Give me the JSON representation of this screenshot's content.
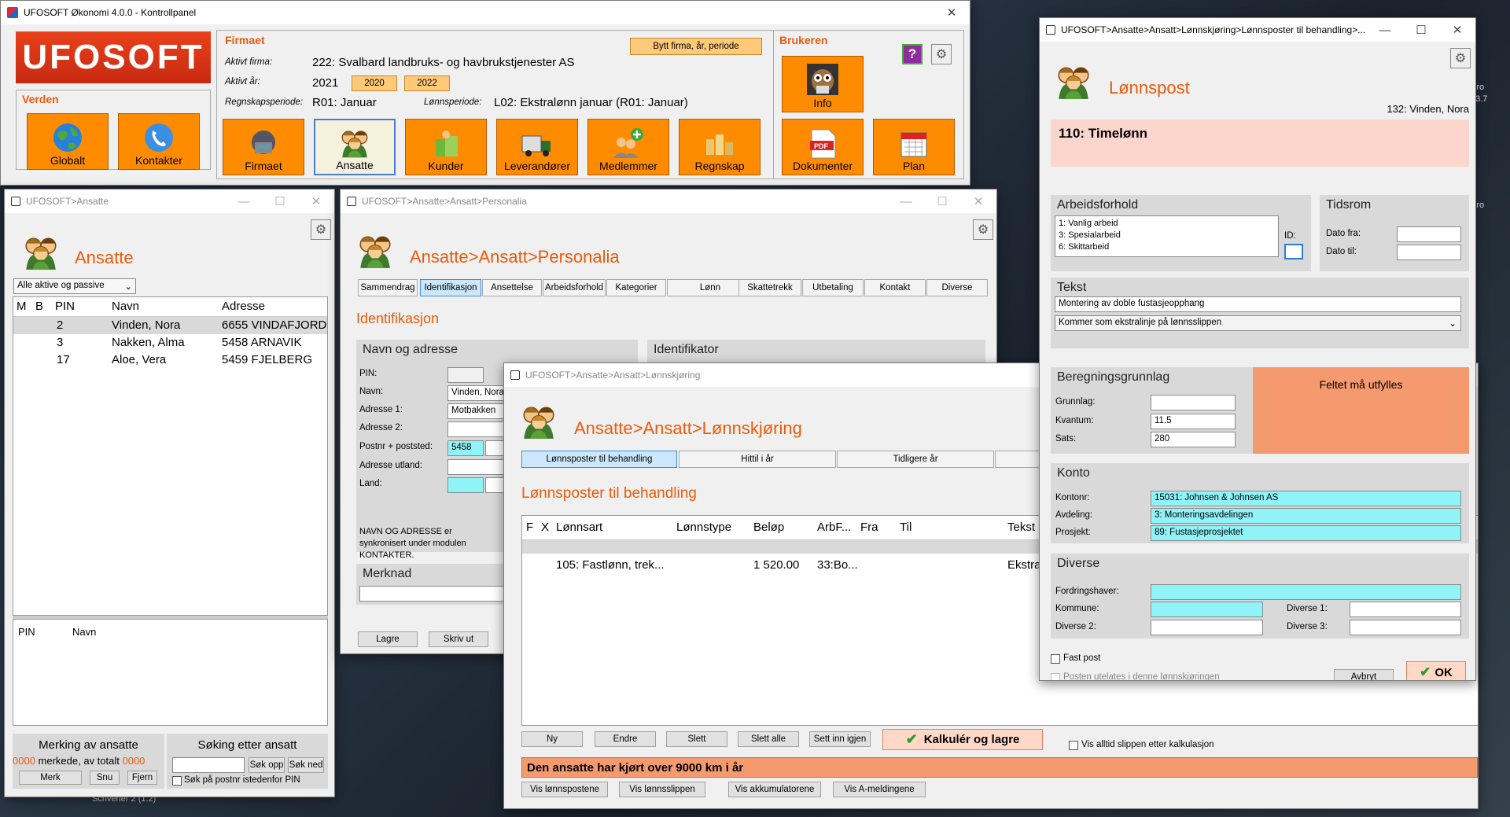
{
  "kontrollpanel": {
    "title": "UFOSOFT Økonomi 4.0.0 - Kontrollpanel",
    "logo": "UFOSOFT",
    "verden": {
      "header": "Verden",
      "globalt": "Globalt",
      "kontakter": "Kontakter"
    },
    "firmaet": {
      "header": "Firmaet",
      "switch_button": "Bytt firma, år, periode",
      "aktivt_firma_label": "Aktivt firma:",
      "aktivt_firma": "222: Svalbard landbruks- og havbrukstjenester AS",
      "aktivt_ar_label": "Aktivt år:",
      "aktivt_ar": "2021",
      "prev_year": "2020",
      "next_year": "2022",
      "regnskapsperiode_label": "Regnskapsperiode:",
      "regnskapsperiode": "R01: Januar",
      "lonnsperiode_label": "Lønnsperiode:",
      "lonnsperiode": "L02: Ekstralønn januar (R01: Januar)"
    },
    "modules": [
      "Firmaet",
      "Ansatte",
      "Kunder",
      "Leverandører",
      "Medlemmer",
      "Regnskap"
    ],
    "brukeren": {
      "header": "Brukeren",
      "help": "?",
      "info": "Info",
      "dokumenter": "Dokumenter",
      "plan": "Plan"
    }
  },
  "ansatte_win": {
    "title": "UFOSOFT>Ansatte",
    "heading": "Ansatte",
    "filter": "Alle aktive og passive",
    "columns": [
      "M",
      "B",
      "PIN",
      "Navn",
      "Adresse"
    ],
    "rows": [
      {
        "pin": "2",
        "navn": "Vinden, Nora",
        "adresse": "6655 VINDAFJORD"
      },
      {
        "pin": "3",
        "navn": "Nakken, Alma",
        "adresse": "5458 ARNAVIK"
      },
      {
        "pin": "17",
        "navn": "Aloe, Vera",
        "adresse": "5459 FJELBERG"
      }
    ],
    "lower_columns": [
      "PIN",
      "Navn"
    ],
    "merking": {
      "header": "Merking av ansatte",
      "count": "0000",
      "text": " merkede, av totalt ",
      "total": "0000",
      "merk": "Merk",
      "snu": "Snu",
      "fjern": "Fjern"
    },
    "soking": {
      "header": "Søking etter ansatt",
      "sok_opp": "Søk opp",
      "sok_ned": "Søk ned",
      "postnr_label": "Søk på postnr istedenfor PIN"
    }
  },
  "personalia_win": {
    "title": "UFOSOFT>Ansatte>Ansatt>Personalia",
    "heading": "Ansatte>Ansatt>Personalia",
    "tabs": [
      "Sammendrag",
      "Identifikasjon",
      "Ansettelse",
      "Arbeidsforhold",
      "Kategorier",
      "Lønn",
      "Skattetrekk",
      "Utbetaling",
      "Kontakt",
      "Diverse"
    ],
    "section": "Identifikasjon",
    "panel_left": "Navn og adresse",
    "panel_right": "Identifikator",
    "pin_label": "PIN:",
    "navn_label": "Navn:",
    "navn": "Vinden, Nora",
    "adr1_label": "Adresse 1:",
    "adr1": "Motbakken",
    "adr2_label": "Adresse 2:",
    "postnr_label": "Postnr + poststed:",
    "postnr": "5458",
    "utland_label": "Adresse utland:",
    "land_label": "Land:",
    "note": "NAVN OG ADRESSE er synkronisert under modulen KONTAKTER.",
    "merknad": "Merknad",
    "lagre": "Lagre",
    "skriv_ut": "Skriv ut"
  },
  "lonnskjoring_win": {
    "title": "UFOSOFT>Ansatte>Ansatt>Lønnskjøring",
    "heading": "Ansatte>Ansatt>Lønnskjøring",
    "tabs": [
      "Lønnsposter til behandling",
      "Hittil i år",
      "Tidligere år"
    ],
    "section": "Lønnsposter til behandling",
    "columns": [
      "F",
      "X",
      "Lønnsart",
      "Lønnstype",
      "Beløp",
      "ArbF...",
      "Fra",
      "Til",
      "Tekst"
    ],
    "row": {
      "lonnsart": "105: Fastlønn, trek...",
      "belop": "1 520.00",
      "arbf": "33:Bo...",
      "tekst": "Ekstra"
    },
    "buttons": [
      "Ny",
      "Endre",
      "Slett",
      "Slett alle",
      "Sett inn igjen"
    ],
    "kalkuler": "Kalkulér og lagre",
    "vis_alltid": "Vis alltid slippen etter kalkulasjon",
    "warning": "Den ansatte har kjørt over 9000 km i år",
    "vis_buttons": [
      "Vis lønnspostene",
      "Vis lønnsslippen",
      "Vis akkumulatorene",
      "Vis A-meldingene"
    ]
  },
  "lonnspost_win": {
    "title": "UFOSOFT>Ansatte>Ansatt>Lønnskjøring>Lønnsposter til behandling>...",
    "heading": "Lønnspost",
    "person": "132: Vinden, Nora",
    "lonnsart": "110: Timelønn",
    "arbeidsforhold": {
      "header": "Arbeidsforhold",
      "items": [
        "1: Vanlig arbeid",
        "3: Spesialarbeid",
        "6: Skittarbeid"
      ],
      "id_label": "ID:"
    },
    "tidsrom": {
      "header": "Tidsrom",
      "fra_label": "Dato fra:",
      "til_label": "Dato til:"
    },
    "tekst": {
      "header": "Tekst",
      "value": "Montering av doble fustasjeopphang",
      "select": "Kommer som ekstralinje på lønnsslippen"
    },
    "beregning": {
      "header": "Beregningsgrunnlag",
      "grunnlag_label": "Grunnlag:",
      "kvantum_label": "Kvantum:",
      "kvantum": "11.5",
      "sats_label": "Sats:",
      "sats": "280"
    },
    "required": "Feltet må utfylles",
    "konto": {
      "header": "Konto",
      "kontonr_label": "Kontonr:",
      "kontonr": "15031: Johnsen & Johnsen AS",
      "avdeling_label": "Avdeling:",
      "avdeling": "3: Monteringsavdelingen",
      "prosjekt_label": "Prosjekt:",
      "prosjekt": "89: Fustasjeprosjektet"
    },
    "diverse": {
      "header": "Diverse",
      "fordring_label": "Fordringshaver:",
      "kommune_label": "Kommune:",
      "div1_label": "Diverse 1:",
      "div2_label": "Diverse 2:",
      "div3_label": "Diverse 3:"
    },
    "fast_post": "Fast post",
    "utelates": "Posten utelates i denne lønnskjøringen",
    "avbryt": "Avbryt",
    "ok": "OK"
  },
  "taskbar_fragment": "Scrivener 2 (1.2)",
  "desktop_fragments": {
    "pro1": "Pro",
    "ver": "33.7",
    "pro2": "Pro"
  },
  "colors": {
    "orange": "#ff8c00",
    "title_orange": "#ea5b0c",
    "cyan": "#8ff3f8",
    "salmon": "#f59a6e",
    "pink": "#fcd6cc"
  }
}
